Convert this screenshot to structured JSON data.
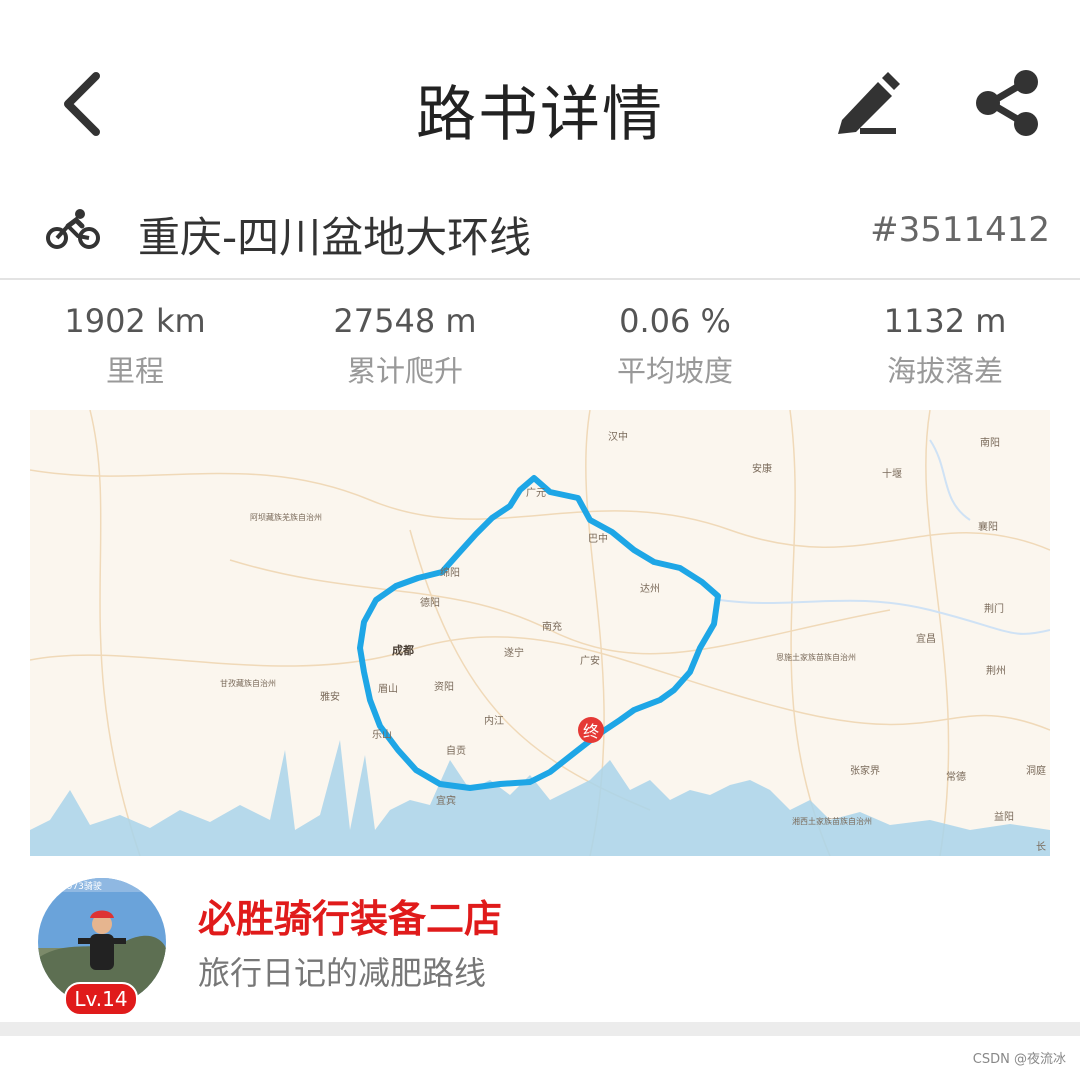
{
  "header": {
    "title": "路书详情",
    "back_icon": "chevron-left-icon",
    "edit_icon": "pencil-icon",
    "share_icon": "share-icon"
  },
  "route": {
    "icon": "bicycle-icon",
    "name": "重庆-四川盆地大环线",
    "id": "#3511412"
  },
  "stats": [
    {
      "value": "1902 km",
      "label": "里程"
    },
    {
      "value": "27548 m",
      "label": "累计爬升"
    },
    {
      "value": "0.06 %",
      "label": "平均坡度"
    },
    {
      "value": "1132 m",
      "label": "海拔落差"
    }
  ],
  "map": {
    "route_color": "#1ea6e6",
    "end_marker": "终",
    "places": [
      "汉中",
      "安康",
      "十堰",
      "南阳",
      "阿坝藏族羌族自治州",
      "广元",
      "巴中",
      "襄阳",
      "绵阳",
      "达州",
      "德阳",
      "南充",
      "荆门",
      "成都",
      "遂宁",
      "广安",
      "宜昌",
      "恩施土家族苗族自治州",
      "荆州",
      "甘孜藏族自治州",
      "雅安",
      "眉山",
      "资阳",
      "内江",
      "乐山",
      "自贡",
      "张家界",
      "常德",
      "洞庭",
      "宜宾",
      "湘西土家族苗族自治州",
      "益阳",
      "长"
    ]
  },
  "user": {
    "name": "必胜骑行装备二店",
    "subtitle": "旅行日记的减肥路线",
    "level": "Lv.14",
    "avatar_caption": "骑1973骑驶"
  },
  "watermark": "CSDN @夜流冰",
  "colors": {
    "accent": "#e01b1b",
    "route": "#1ea6e6"
  }
}
